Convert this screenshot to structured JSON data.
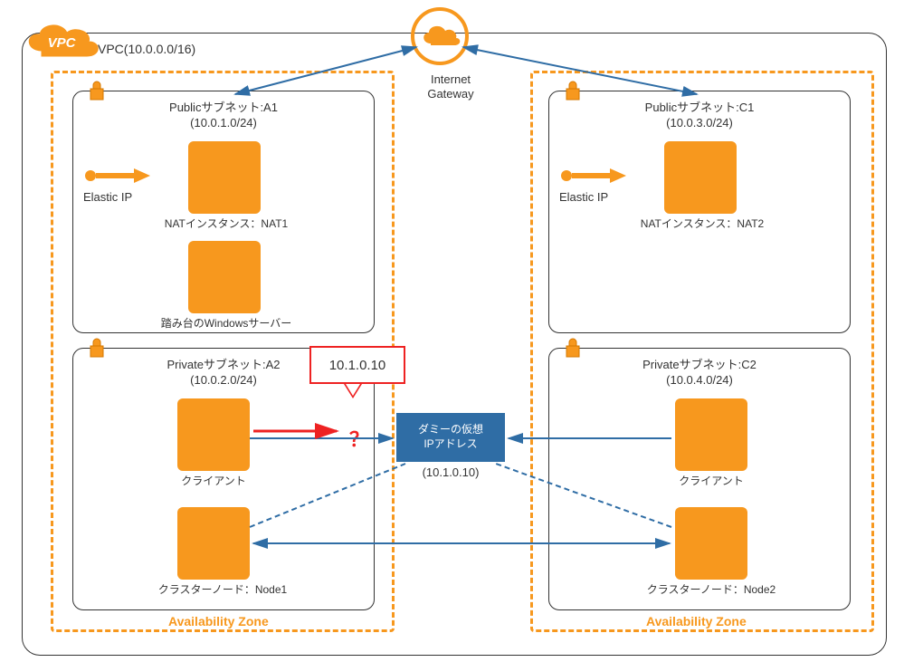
{
  "vpc": {
    "badge": "VPC",
    "label": "VPC(10.0.0.0/16)"
  },
  "igw": {
    "label": "Internet\nGateway"
  },
  "az": {
    "label_left": "Availability Zone",
    "label_right": "Availability Zone"
  },
  "subnets": {
    "a1": {
      "title": "Publicサブネット:A1",
      "cidr": "(10.0.1.0/24)"
    },
    "c1": {
      "title": "Publicサブネット:C1",
      "cidr": "(10.0.3.0/24)"
    },
    "a2": {
      "title": "Privateサブネット:A2",
      "cidr": "(10.0.2.0/24)"
    },
    "c2": {
      "title": "Privateサブネット:C2",
      "cidr": "(10.0.4.0/24)"
    }
  },
  "elastic_ip": "Elastic IP",
  "nat1": "NATインスタンス：NAT1",
  "nat2": "NATインスタンス：NAT2",
  "bastion": "踏み台のWindowsサーバー",
  "client": "クライアント",
  "node1": "クラスターノード：Node1",
  "node2": "クラスターノード：Node2",
  "dummy": {
    "title": "ダミーの仮想\nIPアドレス",
    "ip": "(10.1.0.10)"
  },
  "callout_ip": "10.1.0.10",
  "question": "？",
  "colors": {
    "orange": "#F7981E",
    "blue": "#2F6DA5",
    "red": "#E22"
  }
}
